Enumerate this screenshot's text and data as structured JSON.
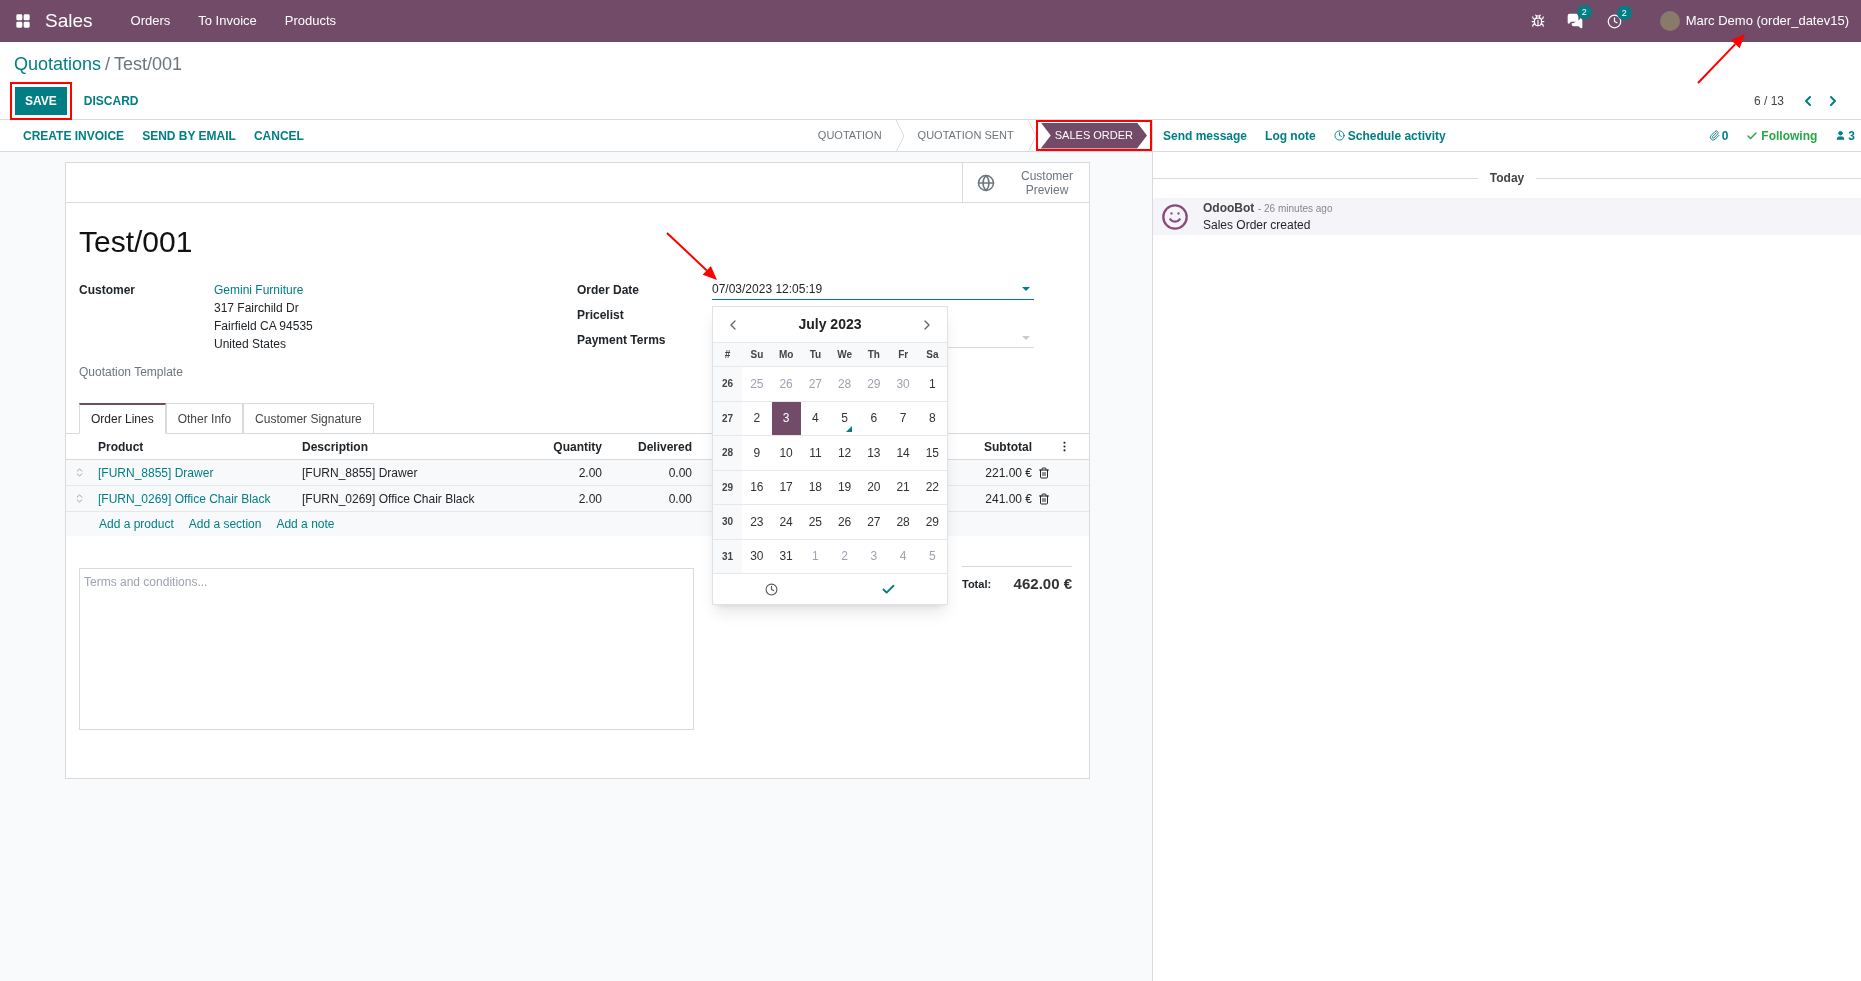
{
  "navbar": {
    "app": "Sales",
    "menu": [
      "Orders",
      "To Invoice",
      "Products"
    ],
    "messages_count": "2",
    "activities_count": "2",
    "user": "Marc Demo (order_datev15)"
  },
  "control_panel": {
    "breadcrumb": {
      "parent": "Quotations",
      "separator": "/",
      "current": "Test/001"
    },
    "save": {
      "label": "SAVE",
      "highlighted": true
    },
    "discard": "DISCARD",
    "pager": "6 / 13"
  },
  "actions": [
    "CREATE INVOICE",
    "SEND BY EMAIL",
    "CANCEL"
  ],
  "status_steps": [
    {
      "label": "QUOTATION",
      "selected": false,
      "highlighted": false
    },
    {
      "label": "QUOTATION SENT",
      "selected": false,
      "highlighted": false
    },
    {
      "label": "SALES ORDER",
      "selected": true,
      "highlighted": true
    }
  ],
  "chatter": {
    "buttons": [
      "Send message",
      "Log note",
      "Schedule activity"
    ],
    "attachments": "0",
    "following": "Following",
    "followers": "3",
    "divider": "Today",
    "messages": [
      {
        "author": "OdooBot",
        "time": "- 26 minutes ago",
        "body": "Sales Order created"
      }
    ]
  },
  "form": {
    "smart_button": "Customer Preview",
    "title": "Test/001",
    "customer": {
      "label": "Customer",
      "name": "Gemini Furniture",
      "address": [
        "317 Fairchild Dr",
        "Fairfield CA 94535",
        "United States"
      ]
    },
    "quotation_template": "Quotation Template",
    "right_fields": [
      "Order Date",
      "Pricelist",
      "Payment Terms"
    ],
    "order_date_value": "07/03/2023 12:05:19",
    "tabs": [
      {
        "label": "Order Lines",
        "selected": true
      },
      {
        "label": "Other Info",
        "selected": false
      },
      {
        "label": "Customer Signature",
        "selected": false
      }
    ],
    "columns": [
      "Product",
      "Description",
      "Quantity",
      "Delivered",
      "Subtotal"
    ],
    "rows": [
      {
        "product": "[FURN_8855] Drawer",
        "description": "[FURN_8855] Drawer",
        "quantity": "2.00",
        "delivered": "0.00",
        "subtotal": "221.00 €"
      },
      {
        "product": "[FURN_0269] Office Chair Black",
        "description": "[FURN_0269] Office Chair Black",
        "quantity": "2.00",
        "delivered": "0.00",
        "subtotal": "241.00 €"
      }
    ],
    "add_links": [
      "Add a product",
      "Add a section",
      "Add a note"
    ],
    "terms_placeholder": "Terms and conditions...",
    "total_label": "Total:",
    "total_value": "462.00 €"
  },
  "calendar": {
    "title": "July 2023",
    "headers": [
      "#",
      "Su",
      "Mo",
      "Tu",
      "We",
      "Th",
      "Fr",
      "Sa"
    ],
    "weeks": [
      {
        "number": "26",
        "days": [
          {
            "label": "25",
            "muted": true,
            "selected": false,
            "today": false
          },
          {
            "label": "26",
            "muted": true,
            "selected": false,
            "today": false
          },
          {
            "label": "27",
            "muted": true,
            "selected": false,
            "today": false
          },
          {
            "label": "28",
            "muted": true,
            "selected": false,
            "today": false
          },
          {
            "label": "29",
            "muted": true,
            "selected": false,
            "today": false
          },
          {
            "label": "30",
            "muted": true,
            "selected": false,
            "today": false
          },
          {
            "label": "1",
            "muted": false,
            "selected": false,
            "today": false
          }
        ]
      },
      {
        "number": "27",
        "days": [
          {
            "label": "2",
            "muted": false,
            "selected": false,
            "today": false
          },
          {
            "label": "3",
            "muted": false,
            "selected": true,
            "today": false
          },
          {
            "label": "4",
            "muted": false,
            "selected": false,
            "today": false
          },
          {
            "label": "5",
            "muted": false,
            "selected": false,
            "today": true
          },
          {
            "label": "6",
            "muted": false,
            "selected": false,
            "today": false
          },
          {
            "label": "7",
            "muted": false,
            "selected": false,
            "today": false
          },
          {
            "label": "8",
            "muted": false,
            "selected": false,
            "today": false
          }
        ]
      },
      {
        "number": "28",
        "days": [
          {
            "label": "9",
            "muted": false,
            "selected": false,
            "today": false
          },
          {
            "label": "10",
            "muted": false,
            "selected": false,
            "today": false
          },
          {
            "label": "11",
            "muted": false,
            "selected": false,
            "today": false
          },
          {
            "label": "12",
            "muted": false,
            "selected": false,
            "today": false
          },
          {
            "label": "13",
            "muted": false,
            "selected": false,
            "today": false
          },
          {
            "label": "14",
            "muted": false,
            "selected": false,
            "today": false
          },
          {
            "label": "15",
            "muted": false,
            "selected": false,
            "today": false
          }
        ]
      },
      {
        "number": "29",
        "days": [
          {
            "label": "16",
            "muted": false,
            "selected": false,
            "today": false
          },
          {
            "label": "17",
            "muted": false,
            "selected": false,
            "today": false
          },
          {
            "label": "18",
            "muted": false,
            "selected": false,
            "today": false
          },
          {
            "label": "19",
            "muted": false,
            "selected": false,
            "today": false
          },
          {
            "label": "20",
            "muted": false,
            "selected": false,
            "today": false
          },
          {
            "label": "21",
            "muted": false,
            "selected": false,
            "today": false
          },
          {
            "label": "22",
            "muted": false,
            "selected": false,
            "today": false
          }
        ]
      },
      {
        "number": "30",
        "days": [
          {
            "label": "23",
            "muted": false,
            "selected": false,
            "today": false
          },
          {
            "label": "24",
            "muted": false,
            "selected": false,
            "today": false
          },
          {
            "label": "25",
            "muted": false,
            "selected": false,
            "today": false
          },
          {
            "label": "26",
            "muted": false,
            "selected": false,
            "today": false
          },
          {
            "label": "27",
            "muted": false,
            "selected": false,
            "today": false
          },
          {
            "label": "28",
            "muted": false,
            "selected": false,
            "today": false
          },
          {
            "label": "29",
            "muted": false,
            "selected": false,
            "today": false
          }
        ]
      },
      {
        "number": "31",
        "days": [
          {
            "label": "30",
            "muted": false,
            "selected": false,
            "today": false
          },
          {
            "label": "31",
            "muted": false,
            "selected": false,
            "today": false
          },
          {
            "label": "1",
            "muted": true,
            "selected": false,
            "today": false
          },
          {
            "label": "2",
            "muted": true,
            "selected": false,
            "today": false
          },
          {
            "label": "3",
            "muted": true,
            "selected": false,
            "today": false
          },
          {
            "label": "4",
            "muted": true,
            "selected": false,
            "today": false
          },
          {
            "label": "5",
            "muted": true,
            "selected": false,
            "today": false
          }
        ]
      }
    ]
  }
}
